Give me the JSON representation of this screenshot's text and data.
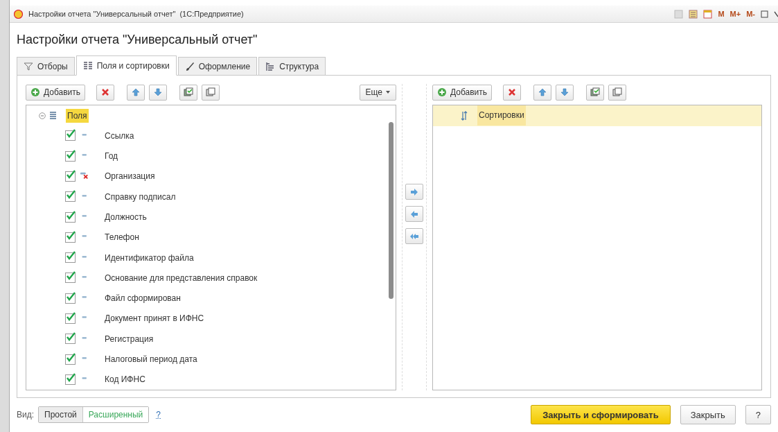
{
  "window": {
    "title": "Настройки отчета \"Универсальный отчет\"  (1С:Предприятие)",
    "memory_buttons": [
      "M",
      "M+",
      "M-"
    ]
  },
  "heading": "Настройки отчета \"Универсальный отчет\"",
  "tabs": [
    {
      "label": "Отборы",
      "kind": "filter",
      "selected": false
    },
    {
      "label": "Поля и сортировки",
      "kind": "fields",
      "selected": true
    },
    {
      "label": "Оформление",
      "kind": "brush",
      "selected": false
    },
    {
      "label": "Структура",
      "kind": "structure",
      "selected": false
    }
  ],
  "fields_panel": {
    "add_label": "Добавить",
    "more_label": "Еще",
    "tree": {
      "label": "Поля",
      "expanded": true,
      "selected": true,
      "children": [
        {
          "label": "Ссылка",
          "checked": true,
          "kind": "field"
        },
        {
          "label": "Год",
          "checked": true,
          "kind": "field"
        },
        {
          "label": "Организация",
          "checked": true,
          "kind": "invalid"
        },
        {
          "label": "Справку подписал",
          "checked": true,
          "kind": "field"
        },
        {
          "label": "Должность",
          "checked": true,
          "kind": "field"
        },
        {
          "label": "Телефон",
          "checked": true,
          "kind": "field"
        },
        {
          "label": "Идентификатор файла",
          "checked": true,
          "kind": "field"
        },
        {
          "label": "Основание для представления справок",
          "checked": true,
          "kind": "field"
        },
        {
          "label": "Файл сформирован",
          "checked": true,
          "kind": "field"
        },
        {
          "label": "Документ принят в ИФНС",
          "checked": true,
          "kind": "field"
        },
        {
          "label": "Регистрация",
          "checked": true,
          "kind": "field"
        },
        {
          "label": "Налоговый период дата",
          "checked": true,
          "kind": "field"
        },
        {
          "label": "Код ИФНС",
          "checked": true,
          "kind": "field"
        }
      ]
    }
  },
  "sort_panel": {
    "add_label": "Добавить",
    "rows": [
      {
        "label": "Сортировки",
        "selected": true
      }
    ]
  },
  "footer": {
    "view_label": "Вид:",
    "view_options": [
      {
        "label": "Простой",
        "selected": false
      },
      {
        "label": "Расширенный",
        "selected": true
      }
    ],
    "help_link": "?",
    "buttons": [
      {
        "label": "Закрыть и сформировать",
        "kind": "primary"
      },
      {
        "label": "Закрыть",
        "kind": "normal"
      },
      {
        "label": "?",
        "kind": "normal"
      }
    ]
  }
}
